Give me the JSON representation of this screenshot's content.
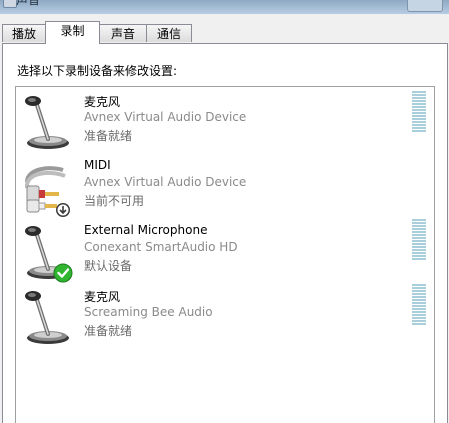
{
  "window": {
    "title": "声音"
  },
  "tabs": [
    {
      "label": "播放",
      "active": false
    },
    {
      "label": "录制",
      "active": true
    },
    {
      "label": "声音",
      "active": false
    },
    {
      "label": "通信",
      "active": false
    }
  ],
  "panel": {
    "instruction": "选择以下录制设备来修改设置:"
  },
  "devices": [
    {
      "name": "麦克风",
      "description": "Avnex Virtual Audio Device",
      "status": "准备就绪",
      "icon": "microphone-icon",
      "badge": null,
      "has_level_meter": true
    },
    {
      "name": "MIDI",
      "description": "Avnex Virtual Audio Device",
      "status": "当前不可用",
      "icon": "rca-cable-icon",
      "badge": "down-arrow-badge-icon",
      "has_level_meter": false
    },
    {
      "name": "External Microphone",
      "description": "Conexant SmartAudio HD",
      "status": "默认设备",
      "icon": "microphone-icon",
      "badge": "green-checkmark-badge-icon",
      "has_level_meter": true
    },
    {
      "name": "麦克风",
      "description": "Screaming Bee Audio",
      "status": "准备就绪",
      "icon": "microphone-icon",
      "badge": null,
      "has_level_meter": true
    }
  ],
  "colors": {
    "level_meter": "#a9cfdc",
    "default_badge": "#2fb52f",
    "description_text": "#8a8a8a"
  }
}
